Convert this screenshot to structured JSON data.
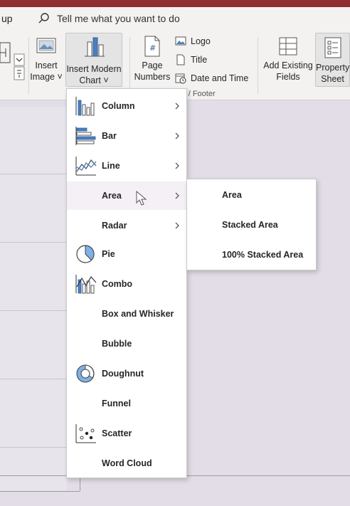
{
  "tell_bar": {
    "left_tab_fragment": "up",
    "search_text": "Tell me what you want to do"
  },
  "ribbon": {
    "insert_image": [
      "Insert",
      "Image ˅"
    ],
    "insert_modern_chart": [
      "Insert Modern",
      "Chart ˅"
    ],
    "page_numbers": [
      "Page",
      "Numbers"
    ],
    "logo": "Logo",
    "title": "Title",
    "date_time": "Date and Time",
    "group_label": "r / Footer",
    "add_existing_fields": [
      "Add Existing",
      "Fields"
    ],
    "property_sheet": [
      "Property",
      "Sheet"
    ]
  },
  "chart_menu": {
    "items": [
      {
        "label": "Column",
        "icon": "column-chart-icon",
        "submenu": true
      },
      {
        "label": "Bar",
        "icon": "bar-chart-icon",
        "submenu": true
      },
      {
        "label": "Line",
        "icon": "line-chart-icon",
        "submenu": true
      },
      {
        "label": "Area",
        "icon": "",
        "submenu": true
      },
      {
        "label": "Radar",
        "icon": "",
        "submenu": true
      },
      {
        "label": "Pie",
        "icon": "pie-chart-icon",
        "submenu": false
      },
      {
        "label": "Combo",
        "icon": "combo-chart-icon",
        "submenu": false
      },
      {
        "label": "Box and Whisker",
        "icon": "",
        "submenu": false
      },
      {
        "label": "Bubble",
        "icon": "",
        "submenu": false
      },
      {
        "label": "Doughnut",
        "icon": "doughnut-chart-icon",
        "submenu": false
      },
      {
        "label": "Funnel",
        "icon": "",
        "submenu": false
      },
      {
        "label": "Scatter",
        "icon": "scatter-chart-icon",
        "submenu": false
      },
      {
        "label": "Word Cloud",
        "icon": "",
        "submenu": false
      }
    ],
    "hovered": "Area"
  },
  "area_submenu": {
    "items": [
      "Area",
      "Stacked Area",
      "100% Stacked Area"
    ]
  },
  "colors": {
    "title_bar": "#8f2f33",
    "chart_blue": "#4a7fc1",
    "menu_hover": "#f5eff6",
    "canvas": "#e2dde6"
  }
}
